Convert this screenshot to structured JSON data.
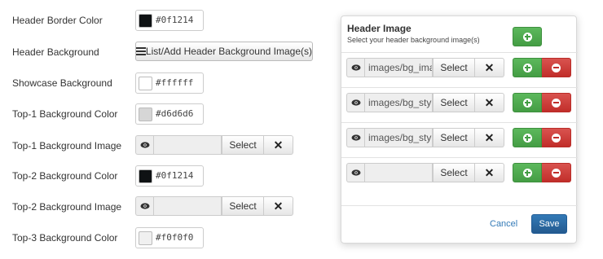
{
  "form": {
    "header_border_color": {
      "label": "Header Border Color",
      "value": "#0f1214",
      "swatch": "#0f1214"
    },
    "header_background": {
      "label": "Header Background",
      "button_label": "List/Add Header Background Image(s)"
    },
    "showcase_background": {
      "label": "Showcase Background",
      "value": "#ffffff",
      "swatch": "#ffffff"
    },
    "top1_bg_color": {
      "label": "Top-1 Background Color",
      "value": "#d6d6d6",
      "swatch": "#d6d6d6"
    },
    "top1_bg_image": {
      "label": "Top-1 Background Image",
      "value": "",
      "select_label": "Select",
      "clear_icon": "close-icon"
    },
    "top2_bg_color": {
      "label": "Top-2 Background Color",
      "value": "#0f1214",
      "swatch": "#0f1214"
    },
    "top2_bg_image": {
      "label": "Top-2 Background Image",
      "value": "",
      "select_label": "Select",
      "clear_icon": "close-icon"
    },
    "top3_bg_color": {
      "label": "Top-3 Background Color",
      "value": "#f0f0f0",
      "swatch": "#f0f0f0"
    }
  },
  "modal": {
    "title": "Header Image",
    "subtitle": "Select your header background image(s)",
    "rows": [
      {
        "path": "images/bg_image",
        "select_label": "Select"
      },
      {
        "path": "images/bg_style",
        "select_label": "Select"
      },
      {
        "path": "images/bg_style",
        "select_label": "Select"
      },
      {
        "path": "",
        "select_label": "Select"
      }
    ],
    "cancel_label": "Cancel",
    "save_label": "Save"
  },
  "colors": {
    "accent": "#337ab7",
    "add_green": "#5cb85c",
    "remove_red": "#d9534f"
  }
}
